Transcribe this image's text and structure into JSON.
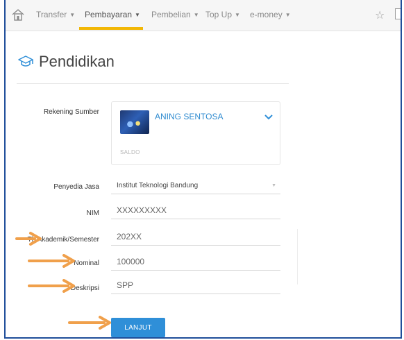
{
  "nav": {
    "items": [
      {
        "label": "Transfer"
      },
      {
        "label": "Pembayaran"
      },
      {
        "label": "Pembelian"
      },
      {
        "label": "Top Up"
      },
      {
        "label": "e-money"
      }
    ],
    "active_index": 1,
    "icons": [
      "home-icon",
      "star-icon",
      "document-icon"
    ]
  },
  "page": {
    "title": "Pendidikan",
    "title_icon": "graduation-cap-icon"
  },
  "form": {
    "rekening_label": "Rekening Sumber",
    "account_name": "ANING SENTOSA",
    "saldo_label": "SALDO",
    "penyedia_label": "Penyedia Jasa",
    "penyedia_value": "Institut Teknologi Bandung",
    "nim_label": "NIM",
    "nim_value": "XXXXXXXXX",
    "semester_label": "Th Akademik/Semester",
    "semester_value": "202XX",
    "nominal_label": "Nominal",
    "nominal_value": "100000",
    "deskripsi_label": "Deskripsi",
    "deskripsi_value": "SPP",
    "submit_label": "LANJUT"
  },
  "colors": {
    "accent_blue": "#2f8fd8",
    "active_underline": "#f2b705",
    "annotation_arrow": "#f0a04b",
    "frame_border": "#1f4e9a"
  }
}
